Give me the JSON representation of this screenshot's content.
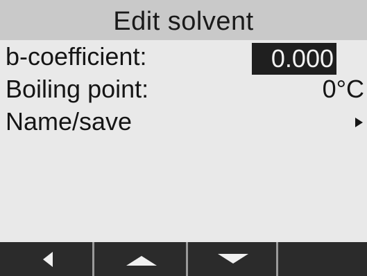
{
  "header": {
    "title": "Edit solvent"
  },
  "menu": {
    "items": [
      {
        "label": "b-coefficient:",
        "value": "0.000",
        "selected": true
      },
      {
        "label": "Boiling point:",
        "value": "0°C",
        "selected": false
      },
      {
        "label": "Name/save",
        "value": "",
        "has_submenu": true,
        "icon": "arrow-right-icon"
      }
    ]
  },
  "softkeys": [
    {
      "icon": "arrow-left-icon"
    },
    {
      "icon": "arrow-up-icon"
    },
    {
      "icon": "arrow-down-icon"
    },
    {
      "icon": ""
    }
  ],
  "colors": {
    "title_bar": "#c9c9c9",
    "background": "#e9e9e9",
    "highlight": "#1f1f1f",
    "softkey_bar": "#2d2d2d"
  }
}
